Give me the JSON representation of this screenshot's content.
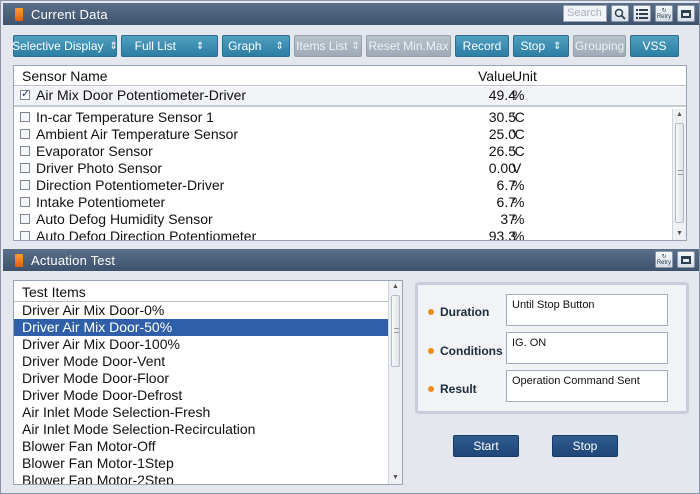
{
  "current_data": {
    "title": "Current Data",
    "search_placeholder": "Search",
    "retry_label": "Retry"
  },
  "toolbar": {
    "selective_display": "Selective Display",
    "full_list": "Full List",
    "graph": "Graph",
    "items_list": "Items List",
    "reset_min_max": "Reset Min.Max",
    "record": "Record",
    "stop": "Stop",
    "grouping": "Grouping",
    "vss": "VSS",
    "dropdown_glyph": "⇕"
  },
  "table": {
    "headers": {
      "name": "Sensor Name",
      "value": "Value",
      "unit": "Unit"
    },
    "pinned": {
      "name": "Air Mix Door Potentiometer-Driver",
      "value": "49.4",
      "unit": "%",
      "checked": true
    },
    "rows": [
      {
        "name": "In-car Temperature Sensor 1",
        "value": "30.5",
        "unit": "'C"
      },
      {
        "name": "Ambient Air Temperature Sensor",
        "value": "25.0",
        "unit": "'C"
      },
      {
        "name": "Evaporator Sensor",
        "value": "26.5",
        "unit": "'C"
      },
      {
        "name": "Driver Photo Sensor",
        "value": "0.00",
        "unit": "V"
      },
      {
        "name": "Direction Potentiometer-Driver",
        "value": "6.7",
        "unit": "%"
      },
      {
        "name": "Intake Potentiometer",
        "value": "6.7",
        "unit": "%"
      },
      {
        "name": "Auto Defog Humidity Sensor",
        "value": "37",
        "unit": "%"
      },
      {
        "name": "Auto Defog Direction Potentiometer",
        "value": "93.3",
        "unit": "%"
      }
    ]
  },
  "actuation": {
    "title": "Actuation Test",
    "retry_label": "Retry",
    "list_header": "Test Items",
    "items": [
      "Driver Air Mix Door-0%",
      "Driver Air Mix Door-50%",
      "Driver Air Mix Door-100%",
      "Driver Mode Door-Vent",
      "Driver Mode Door-Floor",
      "Driver Mode Door-Defrost",
      "Air Inlet Mode Selection-Fresh",
      "Air Inlet Mode Selection-Recirculation",
      "Blower Fan Motor-Off",
      "Blower Fan Motor-1Step",
      "Blower Fan Motor-2Step"
    ],
    "selected_index": 1,
    "duration_label": "Duration",
    "duration_value": "Until Stop Button",
    "conditions_label": "Conditions",
    "conditions_value": "IG. ON",
    "result_label": "Result",
    "result_value": "Operation Command Sent",
    "start_label": "Start",
    "stop_label": "Stop"
  },
  "colors": {
    "accent_button": "#2c7ea3",
    "selected_row": "#2f5fa8",
    "action_button": "#1f4677",
    "title_bar": "#3d526d"
  }
}
